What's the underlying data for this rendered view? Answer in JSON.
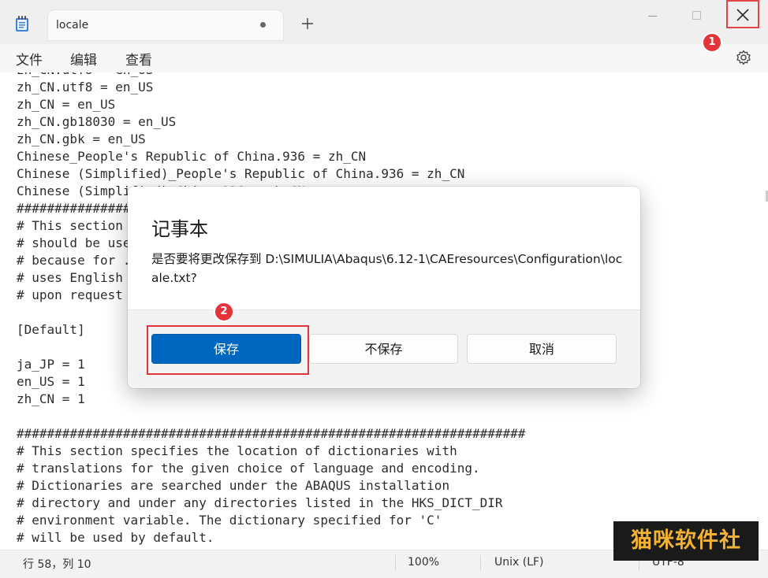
{
  "window": {
    "tab_title": "locale"
  },
  "menu": {
    "file": "文件",
    "edit": "编辑",
    "view": "查看"
  },
  "editor": {
    "lines": "zh_CN.utf8 = en_US\nzh_CN.utf8 = en_US\nzh_CN = en_US\nzh_CN.gb18030 = en_US\nzh_CN.gbk = en_US\nChinese_People's Republic of China.936 = zh_CN\nChinese (Simplified)_People's Republic of China.936 = zh_CN\nChinese (Simplified)_China.936 = zh_CN\n####################################################################\n# This section ...\n# should be used ...\n# because for ...\n# uses English ...\n# upon request ...\n\n[Default]\n\nja_JP = 1\nen_US = 1\nzh_CN = 1\n\n###################################################################\n# This section specifies the location of dictionaries with\n# translations for the given choice of language and encoding.\n# Dictionaries are searched under the ABAQUS installation\n# directory and under any directories listed in the HKS_DICT_DIR\n# environment variable. The dictionary specified for 'C'\n# will be used by default."
  },
  "dialog": {
    "title": "记事本",
    "message": "是否要将更改保存到 D:\\SIMULIA\\Abaqus\\6.12-1\\CAEresources\\Configuration\\locale.txt?",
    "save_label": "保存",
    "dont_save_label": "不保存",
    "cancel_label": "取消"
  },
  "markers": {
    "one": "1",
    "two": "2"
  },
  "status": {
    "position": "行 58，列 10",
    "zoom": "100%",
    "line_ending": "Unix (LF)",
    "encoding": "UTF-8"
  },
  "watermark": "猫咪软件社",
  "colors": {
    "accent": "#0067c0",
    "highlight": "#e0353b"
  }
}
